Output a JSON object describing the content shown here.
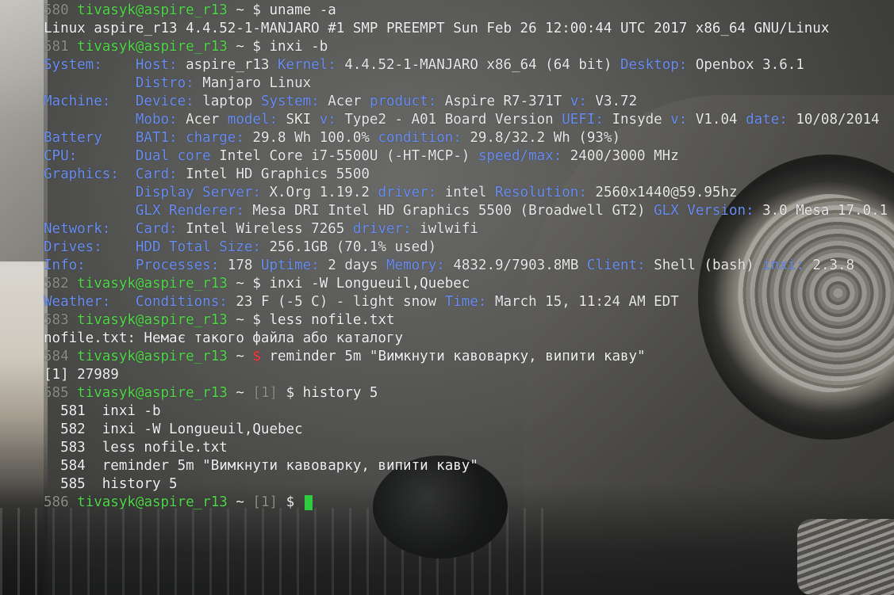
{
  "terminal": {
    "lines": [
      {
        "parts": [
          {
            "c": "ln",
            "t": "580 "
          },
          {
            "c": "user",
            "t": "tivasyk@aspire_r13"
          },
          {
            "c": "out",
            "t": " ~ $ uname -a"
          }
        ]
      },
      {
        "parts": [
          {
            "c": "out",
            "t": "Linux aspire_r13 4.4.52-1-MANJARO #1 SMP PREEMPT Sun Feb 26 12:00:44 UTC 2017 x86_64 GNU/Linux"
          }
        ]
      },
      {
        "parts": [
          {
            "c": "ln",
            "t": "581 "
          },
          {
            "c": "user",
            "t": "tivasyk@aspire_r13"
          },
          {
            "c": "out",
            "t": " ~ $ inxi -b"
          }
        ]
      },
      {
        "parts": [
          {
            "c": "label",
            "t": "System:    Host:"
          },
          {
            "c": "val",
            "t": " aspire_r13 "
          },
          {
            "c": "label",
            "t": "Kernel:"
          },
          {
            "c": "val",
            "t": " 4.4.52-1-MANJARO x86_64 (64 bit) "
          },
          {
            "c": "label",
            "t": "Desktop:"
          },
          {
            "c": "val",
            "t": " Openbox 3.6.1"
          }
        ]
      },
      {
        "parts": [
          {
            "c": "label",
            "t": "           Distro:"
          },
          {
            "c": "val",
            "t": " Manjaro Linux"
          }
        ]
      },
      {
        "parts": [
          {
            "c": "label",
            "t": "Machine:   Device:"
          },
          {
            "c": "val",
            "t": " laptop "
          },
          {
            "c": "label",
            "t": "System:"
          },
          {
            "c": "val",
            "t": " Acer "
          },
          {
            "c": "label",
            "t": "product:"
          },
          {
            "c": "val",
            "t": " Aspire R7-371T "
          },
          {
            "c": "label",
            "t": "v:"
          },
          {
            "c": "val",
            "t": " V3.72"
          }
        ]
      },
      {
        "parts": [
          {
            "c": "label",
            "t": "           Mobo:"
          },
          {
            "c": "val",
            "t": " Acer "
          },
          {
            "c": "label",
            "t": "model:"
          },
          {
            "c": "val",
            "t": " SKI "
          },
          {
            "c": "label",
            "t": "v:"
          },
          {
            "c": "val",
            "t": " Type2 - A01 Board Version "
          },
          {
            "c": "label",
            "t": "UEFI:"
          },
          {
            "c": "val",
            "t": " Insyde "
          },
          {
            "c": "label",
            "t": "v:"
          },
          {
            "c": "val",
            "t": " V1.04 "
          },
          {
            "c": "label",
            "t": "date:"
          },
          {
            "c": "val",
            "t": " 10/08/2014"
          }
        ]
      },
      {
        "parts": [
          {
            "c": "label",
            "t": "Battery    BAT1: charge:"
          },
          {
            "c": "val",
            "t": " 29.8 Wh 100.0% "
          },
          {
            "c": "label",
            "t": "condition:"
          },
          {
            "c": "val",
            "t": " 29.8/32.2 Wh (93%)"
          }
        ]
      },
      {
        "parts": [
          {
            "c": "label",
            "t": "CPU:       Dual core"
          },
          {
            "c": "val",
            "t": " Intel Core i7-5500U (-HT-MCP-) "
          },
          {
            "c": "label",
            "t": "speed/max:"
          },
          {
            "c": "val",
            "t": " 2400/3000 MHz"
          }
        ]
      },
      {
        "parts": [
          {
            "c": "label",
            "t": "Graphics:  Card:"
          },
          {
            "c": "val",
            "t": " Intel HD Graphics 5500"
          }
        ]
      },
      {
        "parts": [
          {
            "c": "label",
            "t": "           Display Server:"
          },
          {
            "c": "val",
            "t": " X.Org 1.19.2 "
          },
          {
            "c": "label",
            "t": "driver:"
          },
          {
            "c": "val",
            "t": " intel "
          },
          {
            "c": "label",
            "t": "Resolution:"
          },
          {
            "c": "val",
            "t": " 2560x1440@59.95hz"
          }
        ]
      },
      {
        "parts": [
          {
            "c": "label",
            "t": "           GLX Renderer:"
          },
          {
            "c": "val",
            "t": " Mesa DRI Intel HD Graphics 5500 (Broadwell GT2) "
          },
          {
            "c": "label",
            "t": "GLX Version:"
          },
          {
            "c": "val",
            "t": " 3.0 Mesa 17.0.1"
          }
        ]
      },
      {
        "parts": [
          {
            "c": "label",
            "t": "Network:   Card:"
          },
          {
            "c": "val",
            "t": " Intel Wireless 7265 "
          },
          {
            "c": "label",
            "t": "driver:"
          },
          {
            "c": "val",
            "t": " iwlwifi"
          }
        ]
      },
      {
        "parts": [
          {
            "c": "label",
            "t": "Drives:    HDD Total Size:"
          },
          {
            "c": "val",
            "t": " 256.1GB (70.1% used)"
          }
        ]
      },
      {
        "parts": [
          {
            "c": "label",
            "t": "Info:      Processes:"
          },
          {
            "c": "val",
            "t": " 178 "
          },
          {
            "c": "label",
            "t": "Uptime:"
          },
          {
            "c": "val",
            "t": " 2 days "
          },
          {
            "c": "label",
            "t": "Memory:"
          },
          {
            "c": "val",
            "t": " 4832.9/7903.8MB "
          },
          {
            "c": "label",
            "t": "Client:"
          },
          {
            "c": "val",
            "t": " Shell (bash) "
          },
          {
            "c": "label",
            "t": "inxi:"
          },
          {
            "c": "val",
            "t": " 2.3.8"
          }
        ]
      },
      {
        "parts": [
          {
            "c": "ln",
            "t": "582 "
          },
          {
            "c": "user",
            "t": "tivasyk@aspire_r13"
          },
          {
            "c": "out",
            "t": " ~ $ inxi -W Longueuil,Quebec"
          }
        ]
      },
      {
        "parts": [
          {
            "c": "label",
            "t": "Weather:   Conditions:"
          },
          {
            "c": "val",
            "t": " 23 F (-5 C) - light snow "
          },
          {
            "c": "label",
            "t": "Time:"
          },
          {
            "c": "val",
            "t": " March 15, 11:24 AM EDT"
          }
        ]
      },
      {
        "parts": [
          {
            "c": "ln",
            "t": "583 "
          },
          {
            "c": "user",
            "t": "tivasyk@aspire_r13"
          },
          {
            "c": "out",
            "t": " ~ $ less nofile.txt"
          }
        ]
      },
      {
        "parts": [
          {
            "c": "out",
            "t": "nofile.txt: Немає такого файла або каталогу"
          }
        ]
      },
      {
        "parts": [
          {
            "c": "ln",
            "t": "584 "
          },
          {
            "c": "user",
            "t": "tivasyk@aspire_r13"
          },
          {
            "c": "out",
            "t": " ~ "
          },
          {
            "c": "red",
            "t": "$"
          },
          {
            "c": "out",
            "t": " reminder 5m \"Вимкнути кавоварку, випити каву\""
          }
        ]
      },
      {
        "parts": [
          {
            "c": "out",
            "t": "[1] 27989"
          }
        ]
      },
      {
        "parts": [
          {
            "c": "ln",
            "t": "585 "
          },
          {
            "c": "user",
            "t": "tivasyk@aspire_r13"
          },
          {
            "c": "out",
            "t": " ~ "
          },
          {
            "c": "dim",
            "t": "[1]"
          },
          {
            "c": "out",
            "t": " $ history 5"
          }
        ]
      },
      {
        "parts": [
          {
            "c": "out",
            "t": "  581  inxi -b"
          }
        ]
      },
      {
        "parts": [
          {
            "c": "out",
            "t": "  582  inxi -W Longueuil,Quebec"
          }
        ]
      },
      {
        "parts": [
          {
            "c": "out",
            "t": "  583  less nofile.txt"
          }
        ]
      },
      {
        "parts": [
          {
            "c": "out",
            "t": "  584  reminder 5m \"Вимкнути кавоварку, випити каву\""
          }
        ]
      },
      {
        "parts": [
          {
            "c": "out",
            "t": "  585  history 5"
          }
        ]
      },
      {
        "parts": [
          {
            "c": "ln",
            "t": "586 "
          },
          {
            "c": "user",
            "t": "tivasyk@aspire_r13"
          },
          {
            "c": "out",
            "t": " ~ "
          },
          {
            "c": "dim",
            "t": "[1]"
          },
          {
            "c": "out",
            "t": " $ "
          }
        ],
        "cursor": true
      }
    ]
  },
  "colors": {
    "prompt_user": "#50d848",
    "label": "#6a8ff2",
    "line_number": "#8c8f88",
    "error_prompt": "#ff3c3c",
    "cursor": "#2ecc40"
  }
}
